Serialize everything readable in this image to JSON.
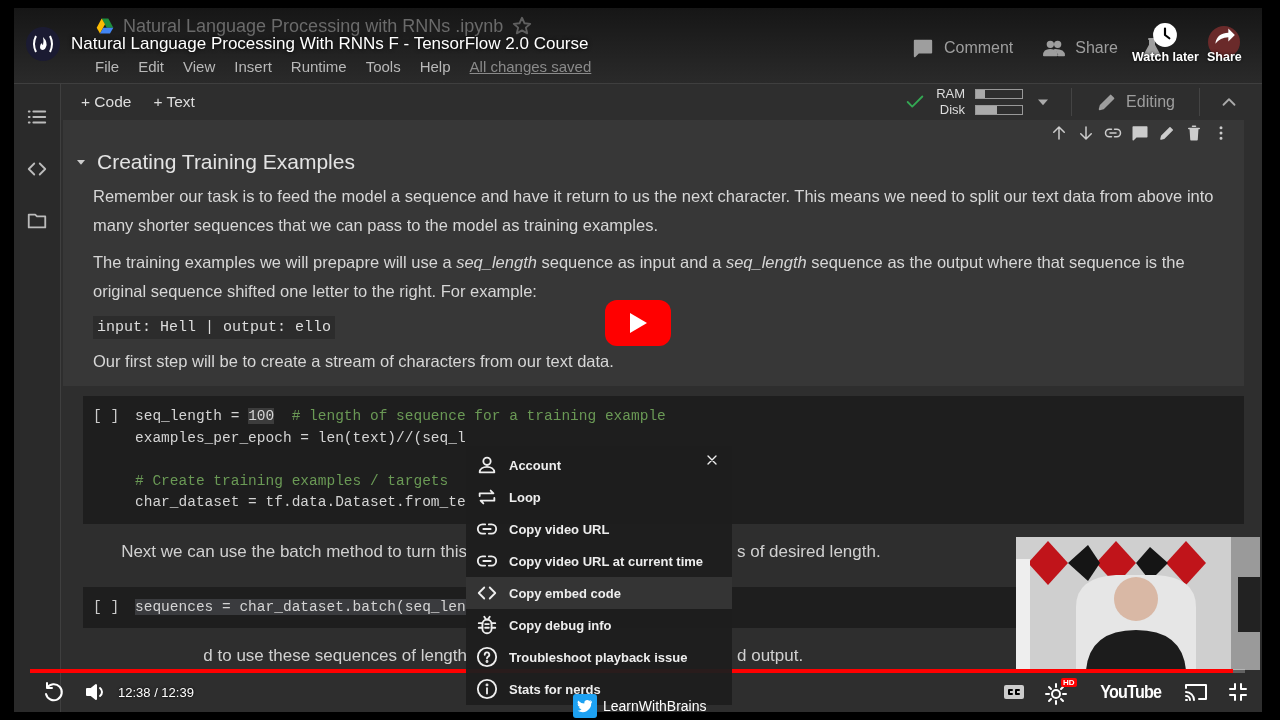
{
  "notebook": {
    "title": "Natural Language Processing with RNNs .ipynb",
    "menu": [
      "File",
      "Edit",
      "View",
      "Insert",
      "Runtime",
      "Tools",
      "Help"
    ],
    "save_status": "All changes saved",
    "header_actions": [
      {
        "kind": "comment",
        "label": "Comment"
      },
      {
        "kind": "share",
        "label": "Share"
      }
    ],
    "toolbar": [
      "+ Code",
      "+ Text"
    ],
    "connected": true,
    "resources": [
      {
        "label": "RAM",
        "level": 0.2
      },
      {
        "label": "Disk",
        "level": 0.45
      }
    ],
    "mode": "Editing",
    "cells": [
      {
        "kind": "text",
        "expanded": true,
        "heading": "Creating Training Examples",
        "blocks": [
          {
            "kind": "paragraph",
            "text": "Remember our task is to feed the model a sequence and have it return to us the next character. This means we need to split our text data from above into many shorter sequences that we can pass to the model as training examples."
          },
          {
            "kind": "paragraph",
            "text": "The training examples we will prepapre will use a *seq_length* sequence as input and a *seq_length* sequence as the output where that sequence is the original sequence shifted one letter to the right. For example:"
          },
          {
            "kind": "code",
            "text": "input: Hell | output: ello"
          },
          {
            "kind": "paragraph",
            "text": "Our first step will be to create a stream of characters from our text data."
          }
        ]
      },
      {
        "kind": "code",
        "run_label": "[ ]",
        "lines": [
          {
            "kind": "line",
            "segments": [
              {
                "kind": "code",
                "text": "seq_length = "
              },
              {
                "kind": "number",
                "text": "100"
              },
              {
                "kind": "comment",
                "text": "  # length of sequence for a training example"
              }
            ]
          },
          {
            "kind": "line",
            "segments": [
              {
                "kind": "code",
                "text": "examples_per_epoch = len(text)//(seq_l"
              }
            ]
          },
          {
            "kind": "blank"
          },
          {
            "kind": "line",
            "segments": [
              {
                "kind": "comment",
                "text": "# Create training examples / targets"
              }
            ]
          },
          {
            "kind": "line",
            "segments": [
              {
                "kind": "code",
                "text": "char_dataset = tf.data.Dataset.from_te"
              }
            ]
          }
        ]
      },
      {
        "kind": "split_text",
        "left": "Next we can use the batch method to turn this",
        "right": "s of desired length."
      },
      {
        "kind": "code",
        "run_label": "[ ]",
        "lines": [
          {
            "kind": "line",
            "segments": [
              {
                "kind": "selected",
                "text": "sequences = char_dataset.batch(seq_len"
              }
            ]
          }
        ]
      },
      {
        "kind": "split_text",
        "left": "d to use these sequences of length",
        "right": "d output."
      }
    ]
  },
  "player": {
    "title": "Natural Language Processing With RNNs F - TensorFlow 2.0 Course",
    "top_actions": [
      {
        "kind": "watch_later",
        "label": "Watch later"
      },
      {
        "kind": "share",
        "label": "Share"
      }
    ],
    "progress": {
      "level": 0.99
    },
    "time": "12:38 / 12:39",
    "quality_badge": "HD",
    "logo_text": "YouTube",
    "channel": "LearnWithBrains",
    "context_menu": {
      "items": [
        {
          "kind": "account",
          "label": "Account",
          "selected": false
        },
        {
          "kind": "loop",
          "label": "Loop",
          "selected": false
        },
        {
          "kind": "link",
          "label": "Copy video URL",
          "selected": false
        },
        {
          "kind": "link",
          "label": "Copy video URL at current time",
          "selected": false
        },
        {
          "kind": "embed",
          "label": "Copy embed code",
          "selected": true
        },
        {
          "kind": "debug",
          "label": "Copy debug info",
          "selected": false
        },
        {
          "kind": "help",
          "label": "Troubleshoot playback issue",
          "selected": false
        },
        {
          "kind": "info",
          "label": "Stats for nerds",
          "selected": false
        }
      ]
    }
  }
}
